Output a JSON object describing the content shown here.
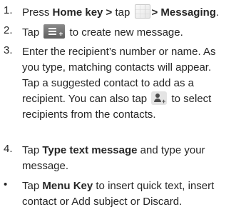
{
  "steps": [
    {
      "number": "1.",
      "parts": [
        "Press ",
        "Home key >",
        " tap ",
        "> Messaging",
        "."
      ]
    },
    {
      "number": "2.",
      "parts": [
        "Tap ",
        "to create new message."
      ]
    },
    {
      "number": "3.",
      "lines": [
        "Enter the recipient’s number or name. As",
        "you type, matching contacts will appear.",
        "Tap a suggested contact to add as a",
        "recipient. You can also tap ",
        "to select",
        "recipients from the contacts."
      ]
    },
    {
      "number": "4.",
      "parts": [
        "Tap ",
        "Type text message",
        " and type your",
        "message."
      ]
    },
    {
      "number": "•",
      "parts": [
        "Tap ",
        "Menu Key",
        " to insert quick text, insert",
        "contact or Add subject or Discard."
      ]
    }
  ],
  "icons": {
    "apps": "apps-grid-icon",
    "compose": "compose-message-icon",
    "contact": "add-contact-icon"
  }
}
